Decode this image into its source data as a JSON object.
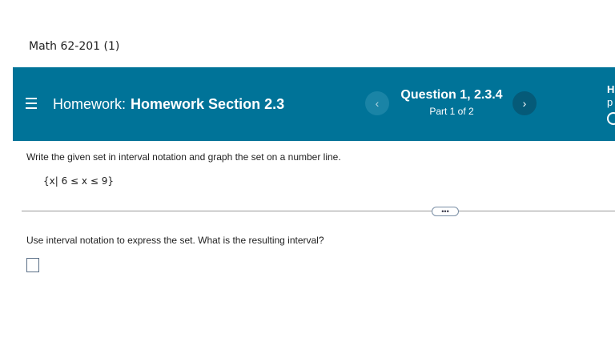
{
  "course": {
    "title": "Math 62-201 (1)"
  },
  "header": {
    "menu_icon": "hamburger-menu-icon",
    "homework_label": "Homework:",
    "homework_name": "Homework Section 2.3",
    "question_title": "Question 1, 2.3.4",
    "question_part": "Part 1 of 2",
    "prev_icon": "chevron-left-icon",
    "next_icon": "chevron-right-icon",
    "prev_symbol": "‹",
    "next_symbol": "›",
    "side_letter": "H",
    "side_text": "p",
    "accent_color": "#007398"
  },
  "problem": {
    "instruction": "Write the given set in interval notation and graph the set on a number line.",
    "set_expression": "{x| 6 ≤ x ≤ 9}",
    "expand_label": "•••",
    "question": "Use interval notation to express the set.  What is the resulting interval?",
    "answer_value": ""
  }
}
